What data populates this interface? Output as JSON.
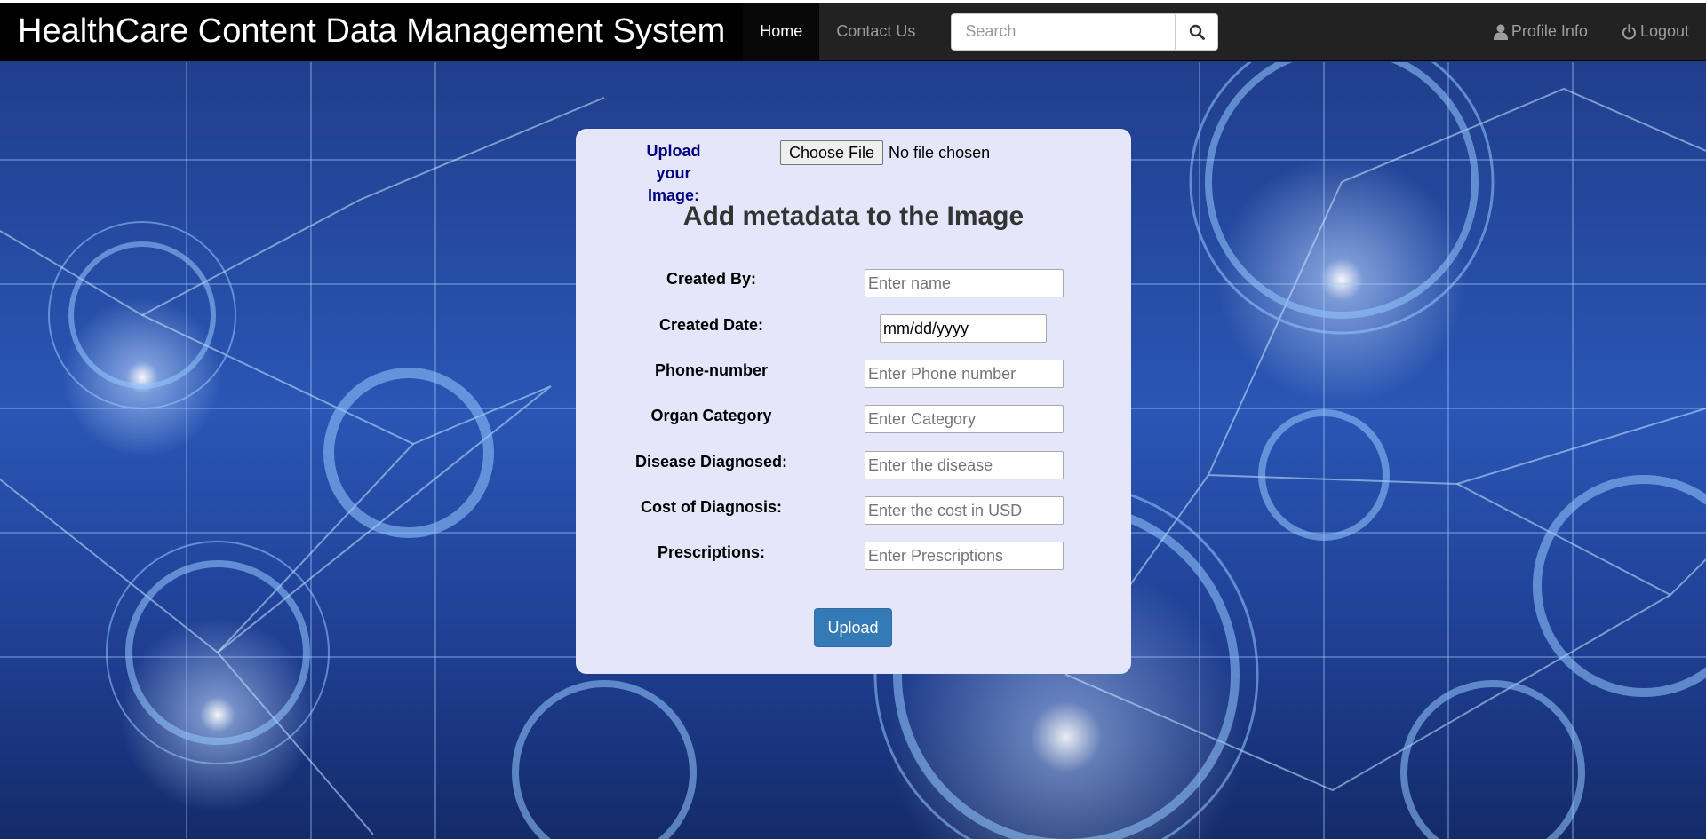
{
  "navbar": {
    "brand": "HealthCare Content Data Management System",
    "links": [
      {
        "label": "Home",
        "active": true
      },
      {
        "label": "Contact Us",
        "active": false
      }
    ],
    "search": {
      "placeholder": "Search",
      "value": "",
      "button_icon": "search-icon"
    },
    "right": [
      {
        "label": "Profile Info",
        "icon": "user-icon"
      },
      {
        "label": "Logout",
        "icon": "power-icon"
      }
    ]
  },
  "form": {
    "upload_label": "Upload your Image:",
    "file_button": "Choose File",
    "file_status": "No file chosen",
    "title": "Add metadata to the Image",
    "fields": [
      {
        "label": "Created By:",
        "placeholder": "Enter name"
      },
      {
        "label": "Created Date:",
        "placeholder": "mm/dd/yyyy"
      },
      {
        "label": "Phone-number",
        "placeholder": "Enter Phone number"
      },
      {
        "label": "Organ Category",
        "placeholder": "Enter Category"
      },
      {
        "label": "Disease Diagnosed:",
        "placeholder": "Enter the disease"
      },
      {
        "label": "Cost of Diagnosis:",
        "placeholder": "Enter the cost in USD"
      },
      {
        "label": "Prescriptions:",
        "placeholder": "Enter Prescriptions"
      }
    ],
    "submit_label": "Upload"
  },
  "colors": {
    "navbar_bg": "#222222",
    "brand_bg": "#000000",
    "card_bg": "#e6e6fa",
    "upload_label": "#000080",
    "primary_button": "#337ab7"
  }
}
